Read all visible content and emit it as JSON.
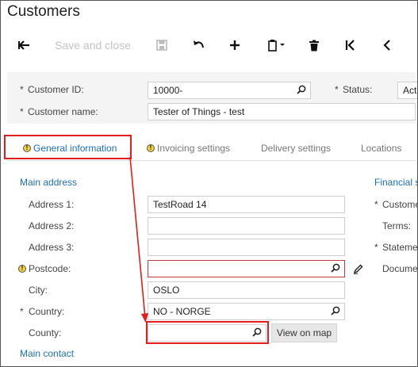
{
  "page": {
    "title": "Customers"
  },
  "toolbar": {
    "back_icon": "back-arrow-icon",
    "save_close_label": "Save and close",
    "save_icon": "floppy-disk-icon",
    "undo_icon": "undo-icon",
    "add_icon": "plus-icon",
    "copy_icon": "clipboard-copy-icon",
    "delete_icon": "trash-icon",
    "first_icon": "first-record-icon",
    "prev_icon": "previous-record-icon"
  },
  "header": {
    "customer_id_label": "Customer ID:",
    "customer_id_value": "10000-",
    "customer_name_label": "Customer name:",
    "customer_name_value": "Tester of Things - test",
    "status_label": "Status:",
    "status_value": "Act"
  },
  "tabs": [
    {
      "label": "General information",
      "warning": true,
      "active": true
    },
    {
      "label": "Invoicing settings",
      "warning": true,
      "active": false
    },
    {
      "label": "Delivery settings",
      "warning": false,
      "active": false
    },
    {
      "label": "Locations",
      "warning": false,
      "active": false
    }
  ],
  "main_address": {
    "section_title": "Main address",
    "address1_label": "Address 1:",
    "address1_value": "TestRoad 14",
    "address2_label": "Address 2:",
    "address2_value": "",
    "address3_label": "Address 3:",
    "address3_value": "",
    "postcode_label": "Postcode:",
    "postcode_value": "",
    "city_label": "City:",
    "city_value": "OSLO",
    "country_label": "Country:",
    "country_value": "NO - NORGE",
    "county_label": "County:",
    "county_value": "",
    "view_on_map_label": "View on map"
  },
  "main_contact": {
    "section_title": "Main contact"
  },
  "financial": {
    "section_title": "Financial s",
    "customer_label": "Custome",
    "terms_label": "Terms:",
    "statement_label": "Stateme",
    "document_label": "Docume"
  },
  "colors": {
    "accent": "#1d6fb8",
    "annotation_red": "#e31c1c",
    "warning_yellow": "#f2d13b",
    "error_border": "#c0393b"
  }
}
